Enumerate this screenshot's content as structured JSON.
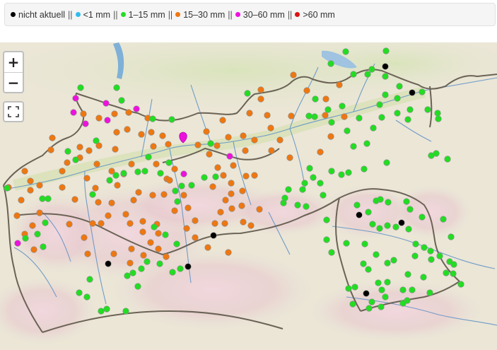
{
  "legend": {
    "items": [
      {
        "label": "nicht aktuell",
        "color": "#000000"
      },
      {
        "label": "<1 mm",
        "color": "#33bbee"
      },
      {
        "label": "1–15 mm",
        "color": "#22dd22"
      },
      {
        "label": "15–30 mm",
        "color": "#ee7711"
      },
      {
        "label": "30–60 mm",
        "color": "#ee11dd"
      },
      {
        "label": ">60 mm",
        "color": "#dd1111"
      }
    ],
    "separator": "||"
  },
  "map_controls": {
    "zoom_in": "+",
    "zoom_out": "−",
    "fullscreen_icon": "fullscreen-icon"
  },
  "stations": {
    "black": [
      [
        545,
        94
      ],
      [
        583,
        131
      ],
      [
        508,
        304
      ],
      [
        568,
        315
      ],
      [
        302,
        333
      ],
      [
        153,
        373
      ],
      [
        266,
        377
      ],
      [
        518,
        415
      ]
    ],
    "magenta": [
      [
        107,
        139
      ],
      [
        150,
        146
      ],
      [
        193,
        154
      ],
      [
        104,
        159
      ],
      [
        121,
        175
      ],
      [
        152,
        170
      ],
      [
        259,
        195
      ],
      [
        325,
        221
      ],
      [
        260,
        246
      ],
      [
        25,
        344
      ]
    ],
    "orange": [
      [
        415,
        106
      ],
      [
        434,
        128
      ],
      [
        480,
        120
      ],
      [
        461,
        140
      ],
      [
        369,
        127
      ],
      [
        369,
        140
      ],
      [
        353,
        160
      ],
      [
        378,
        163
      ],
      [
        383,
        181
      ],
      [
        412,
        164
      ],
      [
        460,
        163
      ],
      [
        487,
        165
      ],
      [
        468,
        193
      ],
      [
        453,
        215
      ],
      [
        410,
        223
      ],
      [
        396,
        198
      ],
      [
        384,
        213
      ],
      [
        360,
        198
      ],
      [
        344,
        192
      ],
      [
        347,
        213
      ],
      [
        315,
        170
      ],
      [
        323,
        194
      ],
      [
        307,
        206
      ],
      [
        292,
        186
      ],
      [
        280,
        205
      ],
      [
        296,
        218
      ],
      [
        330,
        234
      ],
      [
        316,
        248
      ],
      [
        308,
        237
      ],
      [
        301,
        264
      ],
      [
        327,
        259
      ],
      [
        327,
        274
      ],
      [
        343,
        270
      ],
      [
        319,
        283
      ],
      [
        328,
        295
      ],
      [
        360,
        248
      ],
      [
        348,
        249
      ],
      [
        367,
        296
      ],
      [
        355,
        319
      ],
      [
        344,
        314
      ],
      [
        342,
        291
      ],
      [
        312,
        300
      ],
      [
        304,
        316
      ],
      [
        318,
        316
      ],
      [
        323,
        357
      ],
      [
        294,
        350
      ],
      [
        276,
        336
      ],
      [
        276,
        312
      ],
      [
        264,
        323
      ],
      [
        266,
        294
      ],
      [
        247,
        298
      ],
      [
        260,
        276
      ],
      [
        236,
        253
      ],
      [
        247,
        239
      ],
      [
        221,
        232
      ],
      [
        217,
        207
      ],
      [
        238,
        204
      ],
      [
        230,
        192
      ],
      [
        214,
        187
      ],
      [
        180,
        183
      ],
      [
        165,
        187
      ],
      [
        163,
        211
      ],
      [
        140,
        206
      ],
      [
        126,
        213
      ],
      [
        113,
        223
      ],
      [
        123,
        252
      ],
      [
        137,
        232
      ],
      [
        158,
        242
      ],
      [
        175,
        246
      ],
      [
        186,
        232
      ],
      [
        166,
        262
      ],
      [
        158,
        287
      ],
      [
        153,
        305
      ],
      [
        139,
        286
      ],
      [
        143,
        316
      ],
      [
        131,
        316
      ],
      [
        119,
        336
      ],
      [
        124,
        359
      ],
      [
        161,
        359
      ],
      [
        186,
        352
      ],
      [
        184,
        372
      ],
      [
        203,
        361
      ],
      [
        213,
        343
      ],
      [
        224,
        352
      ],
      [
        235,
        363
      ],
      [
        224,
        330
      ],
      [
        222,
        317
      ],
      [
        202,
        328
      ],
      [
        202,
        313
      ],
      [
        184,
        316
      ],
      [
        178,
        303
      ],
      [
        189,
        283
      ],
      [
        196,
        272
      ],
      [
        216,
        276
      ],
      [
        232,
        275
      ],
      [
        240,
        255
      ],
      [
        113,
        208
      ],
      [
        95,
        230
      ],
      [
        88,
        242
      ],
      [
        74,
        195
      ],
      [
        72,
        212
      ],
      [
        35,
        242
      ],
      [
        43,
        256
      ],
      [
        43,
        269
      ],
      [
        56,
        262
      ],
      [
        30,
        283
      ],
      [
        56,
        301
      ],
      [
        46,
        319
      ],
      [
        35,
        331
      ],
      [
        48,
        353
      ],
      [
        24,
        305
      ],
      [
        12,
        265
      ],
      [
        88,
        265
      ],
      [
        106,
        282
      ],
      [
        98,
        317
      ],
      [
        135,
        266
      ],
      [
        118,
        161
      ],
      [
        140,
        167
      ],
      [
        162,
        161
      ],
      [
        182,
        159
      ],
      [
        209,
        167
      ],
      [
        200,
        190
      ]
    ],
    "green": [
      [
        489,
        73
      ],
      [
        546,
        72
      ],
      [
        468,
        90
      ],
      [
        500,
        105
      ],
      [
        520,
        105
      ],
      [
        526,
        98
      ],
      [
        545,
        108
      ],
      [
        545,
        134
      ],
      [
        565,
        122
      ],
      [
        562,
        139
      ],
      [
        597,
        130
      ],
      [
        580,
        155
      ],
      [
        577,
        169
      ],
      [
        562,
        160
      ],
      [
        537,
        148
      ],
      [
        540,
        166
      ],
      [
        528,
        181
      ],
      [
        519,
        203
      ],
      [
        500,
        207
      ],
      [
        491,
        185
      ],
      [
        508,
        167
      ],
      [
        469,
        173
      ],
      [
        464,
        155
      ],
      [
        484,
        150
      ],
      [
        445,
        165
      ],
      [
        446,
        140
      ],
      [
        437,
        164
      ],
      [
        438,
        238
      ],
      [
        469,
        242
      ],
      [
        483,
        247
      ],
      [
        493,
        244
      ],
      [
        515,
        239
      ],
      [
        547,
        230
      ],
      [
        610,
        220
      ],
      [
        617,
        217
      ],
      [
        633,
        225
      ],
      [
        605,
        155
      ],
      [
        619,
        160
      ],
      [
        620,
        168
      ],
      [
        350,
        132
      ],
      [
        114,
        124
      ],
      [
        165,
        124
      ],
      [
        172,
        142
      ],
      [
        216,
        168
      ],
      [
        243,
        169
      ],
      [
        195,
        243
      ],
      [
        205,
        242
      ],
      [
        210,
        222
      ],
      [
        239,
        230
      ],
      [
        298,
        203
      ],
      [
        175,
        245
      ],
      [
        155,
        255
      ],
      [
        164,
        248
      ],
      [
        60,
        281
      ],
      [
        68,
        281
      ],
      [
        36,
        337
      ],
      [
        131,
        275
      ],
      [
        10,
        266
      ],
      [
        408,
        268
      ],
      [
        428,
        268
      ],
      [
        453,
        259
      ],
      [
        443,
        251
      ],
      [
        431,
        259
      ],
      [
        457,
        276
      ],
      [
        433,
        292
      ],
      [
        421,
        290
      ],
      [
        401,
        287
      ],
      [
        403,
        280
      ],
      [
        462,
        311
      ],
      [
        462,
        339
      ],
      [
        469,
        357
      ],
      [
        490,
        344
      ],
      [
        516,
        345
      ],
      [
        527,
        317
      ],
      [
        521,
        300
      ],
      [
        505,
        290
      ],
      [
        532,
        284
      ],
      [
        538,
        282
      ],
      [
        549,
        286
      ],
      [
        575,
        285
      ],
      [
        580,
        296
      ],
      [
        597,
        307
      ],
      [
        578,
        324
      ],
      [
        560,
        321
      ],
      [
        548,
        319
      ],
      [
        537,
        323
      ],
      [
        588,
        345
      ],
      [
        600,
        350
      ],
      [
        609,
        355
      ],
      [
        587,
        362
      ],
      [
        610,
        367
      ],
      [
        627,
        310
      ],
      [
        638,
        335
      ],
      [
        622,
        362
      ],
      [
        636,
        370
      ],
      [
        642,
        374
      ],
      [
        631,
        386
      ],
      [
        641,
        387
      ],
      [
        652,
        402
      ],
      [
        599,
        392
      ],
      [
        577,
        388
      ],
      [
        570,
        410
      ],
      [
        583,
        410
      ],
      [
        608,
        414
      ],
      [
        548,
        399
      ],
      [
        535,
        400
      ],
      [
        540,
        410
      ],
      [
        521,
        381
      ],
      [
        514,
        373
      ],
      [
        493,
        408
      ],
      [
        502,
        406
      ],
      [
        526,
        427
      ],
      [
        545,
        420
      ],
      [
        576,
        425
      ],
      [
        570,
        429
      ],
      [
        539,
        434
      ],
      [
        499,
        430
      ],
      [
        522,
        436
      ],
      [
        548,
        372
      ],
      [
        557,
        368
      ],
      [
        532,
        360
      ],
      [
        127,
        395
      ],
      [
        112,
        414
      ],
      [
        123,
        420
      ],
      [
        143,
        440
      ],
      [
        151,
        437
      ],
      [
        178,
        440
      ],
      [
        195,
        405
      ],
      [
        180,
        390
      ],
      [
        188,
        386
      ],
      [
        200,
        380
      ],
      [
        208,
        370
      ],
      [
        226,
        373
      ],
      [
        244,
        385
      ],
      [
        255,
        380
      ],
      [
        250,
        345
      ],
      [
        234,
        332
      ],
      [
        218,
        321
      ],
      [
        251,
        285
      ],
      [
        248,
        270
      ],
      [
        257,
        263
      ],
      [
        271,
        262
      ],
      [
        289,
        251
      ],
      [
        305,
        250
      ],
      [
        227,
        245
      ],
      [
        136,
        199
      ],
      [
        107,
        226
      ],
      [
        96,
        214
      ],
      [
        53,
        331
      ],
      [
        64,
        315
      ],
      [
        61,
        349
      ]
    ]
  }
}
